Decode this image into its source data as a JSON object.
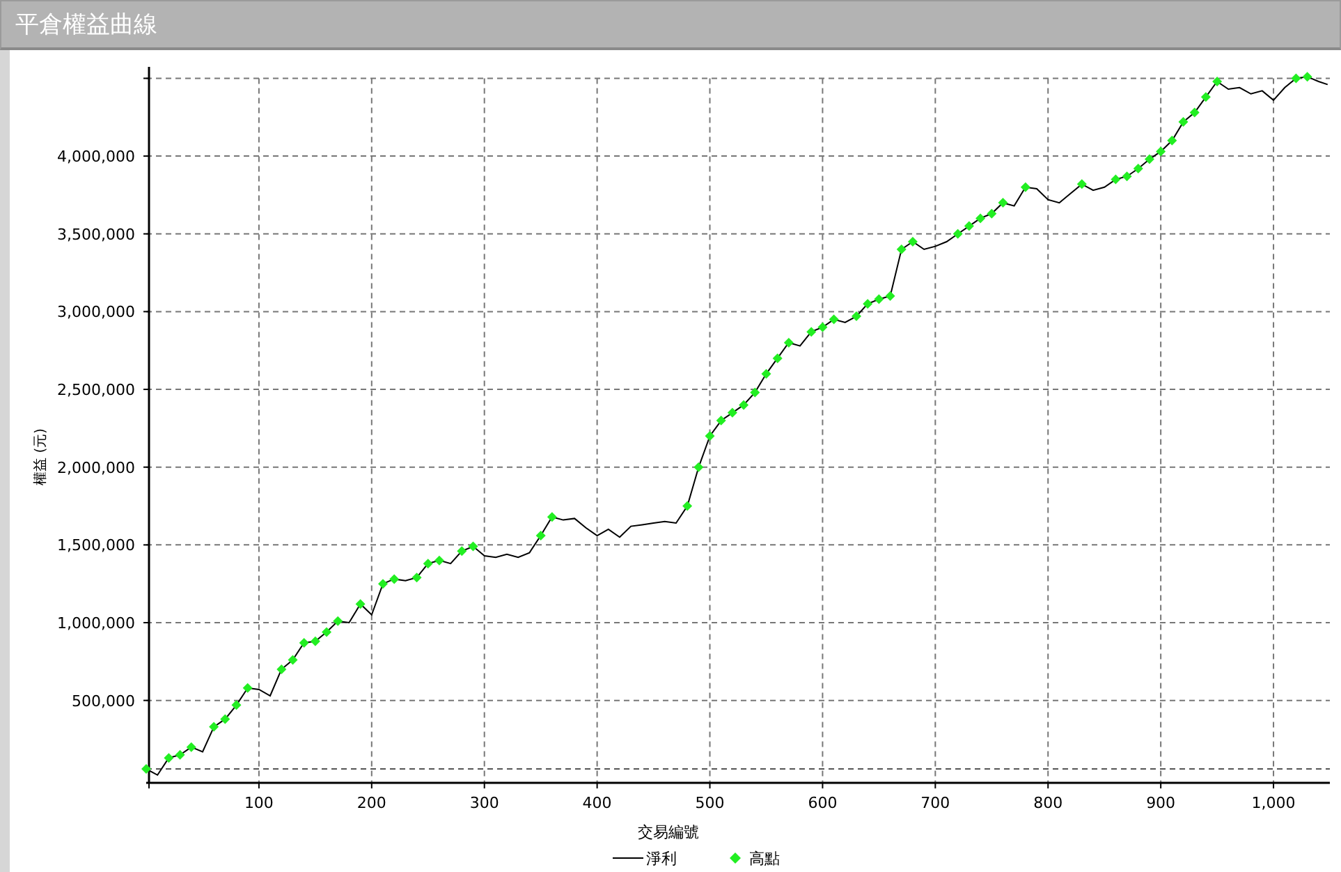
{
  "window": {
    "title": "平倉權益曲線"
  },
  "chart": {
    "chart_data": {
      "type": "line",
      "grid": true,
      "legend": "bottom",
      "ref_lines": [
        {
          "axis": "y",
          "value": 60000
        }
      ],
      "xlabel": "交易編號",
      "ylabel": "權益 (元)",
      "xlim": [
        0,
        1050
      ],
      "ylim": [
        -30000,
        4520000
      ],
      "xticks": [
        {
          "value": 100,
          "label": "100"
        },
        {
          "value": 200,
          "label": "200"
        },
        {
          "value": 300,
          "label": "300"
        },
        {
          "value": 400,
          "label": "400"
        },
        {
          "value": 500,
          "label": "500"
        },
        {
          "value": 600,
          "label": "600"
        },
        {
          "value": 700,
          "label": "700"
        },
        {
          "value": 800,
          "label": "800"
        },
        {
          "value": 900,
          "label": "900"
        },
        {
          "value": 1000,
          "label": "1,000"
        }
      ],
      "yticks": [
        {
          "value": 500000,
          "label": "500,000"
        },
        {
          "value": 1000000,
          "label": "1,000,000"
        },
        {
          "value": 1500000,
          "label": "1,500,000"
        },
        {
          "value": 2000000,
          "label": "2,000,000"
        },
        {
          "value": 2500000,
          "label": "2,500,000"
        },
        {
          "value": 3000000,
          "label": "3,000,000"
        },
        {
          "value": 3500000,
          "label": "3,500,000"
        },
        {
          "value": 4000000,
          "label": "4,000,000"
        }
      ],
      "x": [
        0,
        10,
        20,
        30,
        40,
        50,
        60,
        70,
        80,
        90,
        100,
        110,
        120,
        130,
        140,
        150,
        160,
        170,
        180,
        190,
        200,
        210,
        220,
        230,
        240,
        250,
        260,
        270,
        280,
        290,
        300,
        310,
        320,
        330,
        340,
        350,
        360,
        370,
        380,
        390,
        400,
        410,
        420,
        430,
        440,
        450,
        460,
        470,
        480,
        490,
        500,
        510,
        520,
        530,
        540,
        550,
        560,
        570,
        580,
        590,
        600,
        610,
        620,
        630,
        640,
        650,
        660,
        670,
        680,
        690,
        700,
        710,
        720,
        730,
        740,
        750,
        760,
        770,
        780,
        790,
        800,
        810,
        820,
        830,
        840,
        850,
        860,
        870,
        880,
        890,
        900,
        910,
        920,
        930,
        940,
        950,
        960,
        970,
        980,
        990,
        1000,
        1010,
        1020,
        1030,
        1040,
        1048
      ],
      "series": [
        {
          "name": "淨利",
          "type": "line",
          "color": "#000000",
          "values": [
            60000,
            20000,
            130000,
            150000,
            200000,
            170000,
            330000,
            380000,
            470000,
            580000,
            570000,
            530000,
            700000,
            760000,
            870000,
            880000,
            940000,
            1010000,
            1000000,
            1120000,
            1050000,
            1250000,
            1280000,
            1270000,
            1290000,
            1380000,
            1400000,
            1380000,
            1460000,
            1490000,
            1430000,
            1420000,
            1440000,
            1420000,
            1450000,
            1560000,
            1680000,
            1660000,
            1670000,
            1610000,
            1560000,
            1600000,
            1550000,
            1620000,
            1630000,
            1640000,
            1650000,
            1640000,
            1750000,
            2000000,
            2200000,
            2300000,
            2350000,
            2400000,
            2480000,
            2600000,
            2700000,
            2800000,
            2780000,
            2870000,
            2900000,
            2950000,
            2930000,
            2970000,
            3050000,
            3080000,
            3100000,
            3400000,
            3450000,
            3400000,
            3420000,
            3450000,
            3500000,
            3550000,
            3600000,
            3630000,
            3700000,
            3680000,
            3800000,
            3790000,
            3720000,
            3700000,
            3760000,
            3820000,
            3780000,
            3800000,
            3850000,
            3870000,
            3920000,
            3980000,
            4030000,
            4100000,
            4220000,
            4280000,
            4380000,
            4480000,
            4430000,
            4440000,
            4400000,
            4420000,
            4360000,
            4440000,
            4500000,
            4510000,
            4480000,
            4460000
          ]
        },
        {
          "name": "高點",
          "type": "scatter",
          "color": "#22ee22",
          "values": [
            60000,
            null,
            130000,
            150000,
            200000,
            null,
            330000,
            380000,
            470000,
            580000,
            null,
            null,
            700000,
            760000,
            870000,
            880000,
            940000,
            1010000,
            null,
            1120000,
            null,
            1250000,
            1280000,
            null,
            1290000,
            1380000,
            1400000,
            null,
            1460000,
            1490000,
            null,
            null,
            null,
            null,
            null,
            1560000,
            1680000,
            null,
            null,
            null,
            null,
            null,
            null,
            null,
            null,
            null,
            null,
            null,
            1750000,
            2000000,
            2200000,
            2300000,
            2350000,
            2400000,
            2480000,
            2600000,
            2700000,
            2800000,
            null,
            2870000,
            2900000,
            2950000,
            null,
            2970000,
            3050000,
            3080000,
            3100000,
            3400000,
            3450000,
            null,
            null,
            null,
            3500000,
            3550000,
            3600000,
            3630000,
            3700000,
            null,
            3800000,
            null,
            null,
            null,
            null,
            3820000,
            null,
            null,
            3850000,
            3870000,
            3920000,
            3980000,
            4030000,
            4100000,
            4220000,
            4280000,
            4380000,
            4480000,
            null,
            null,
            null,
            null,
            null,
            null,
            4500000,
            4510000,
            null,
            null
          ]
        }
      ]
    }
  }
}
